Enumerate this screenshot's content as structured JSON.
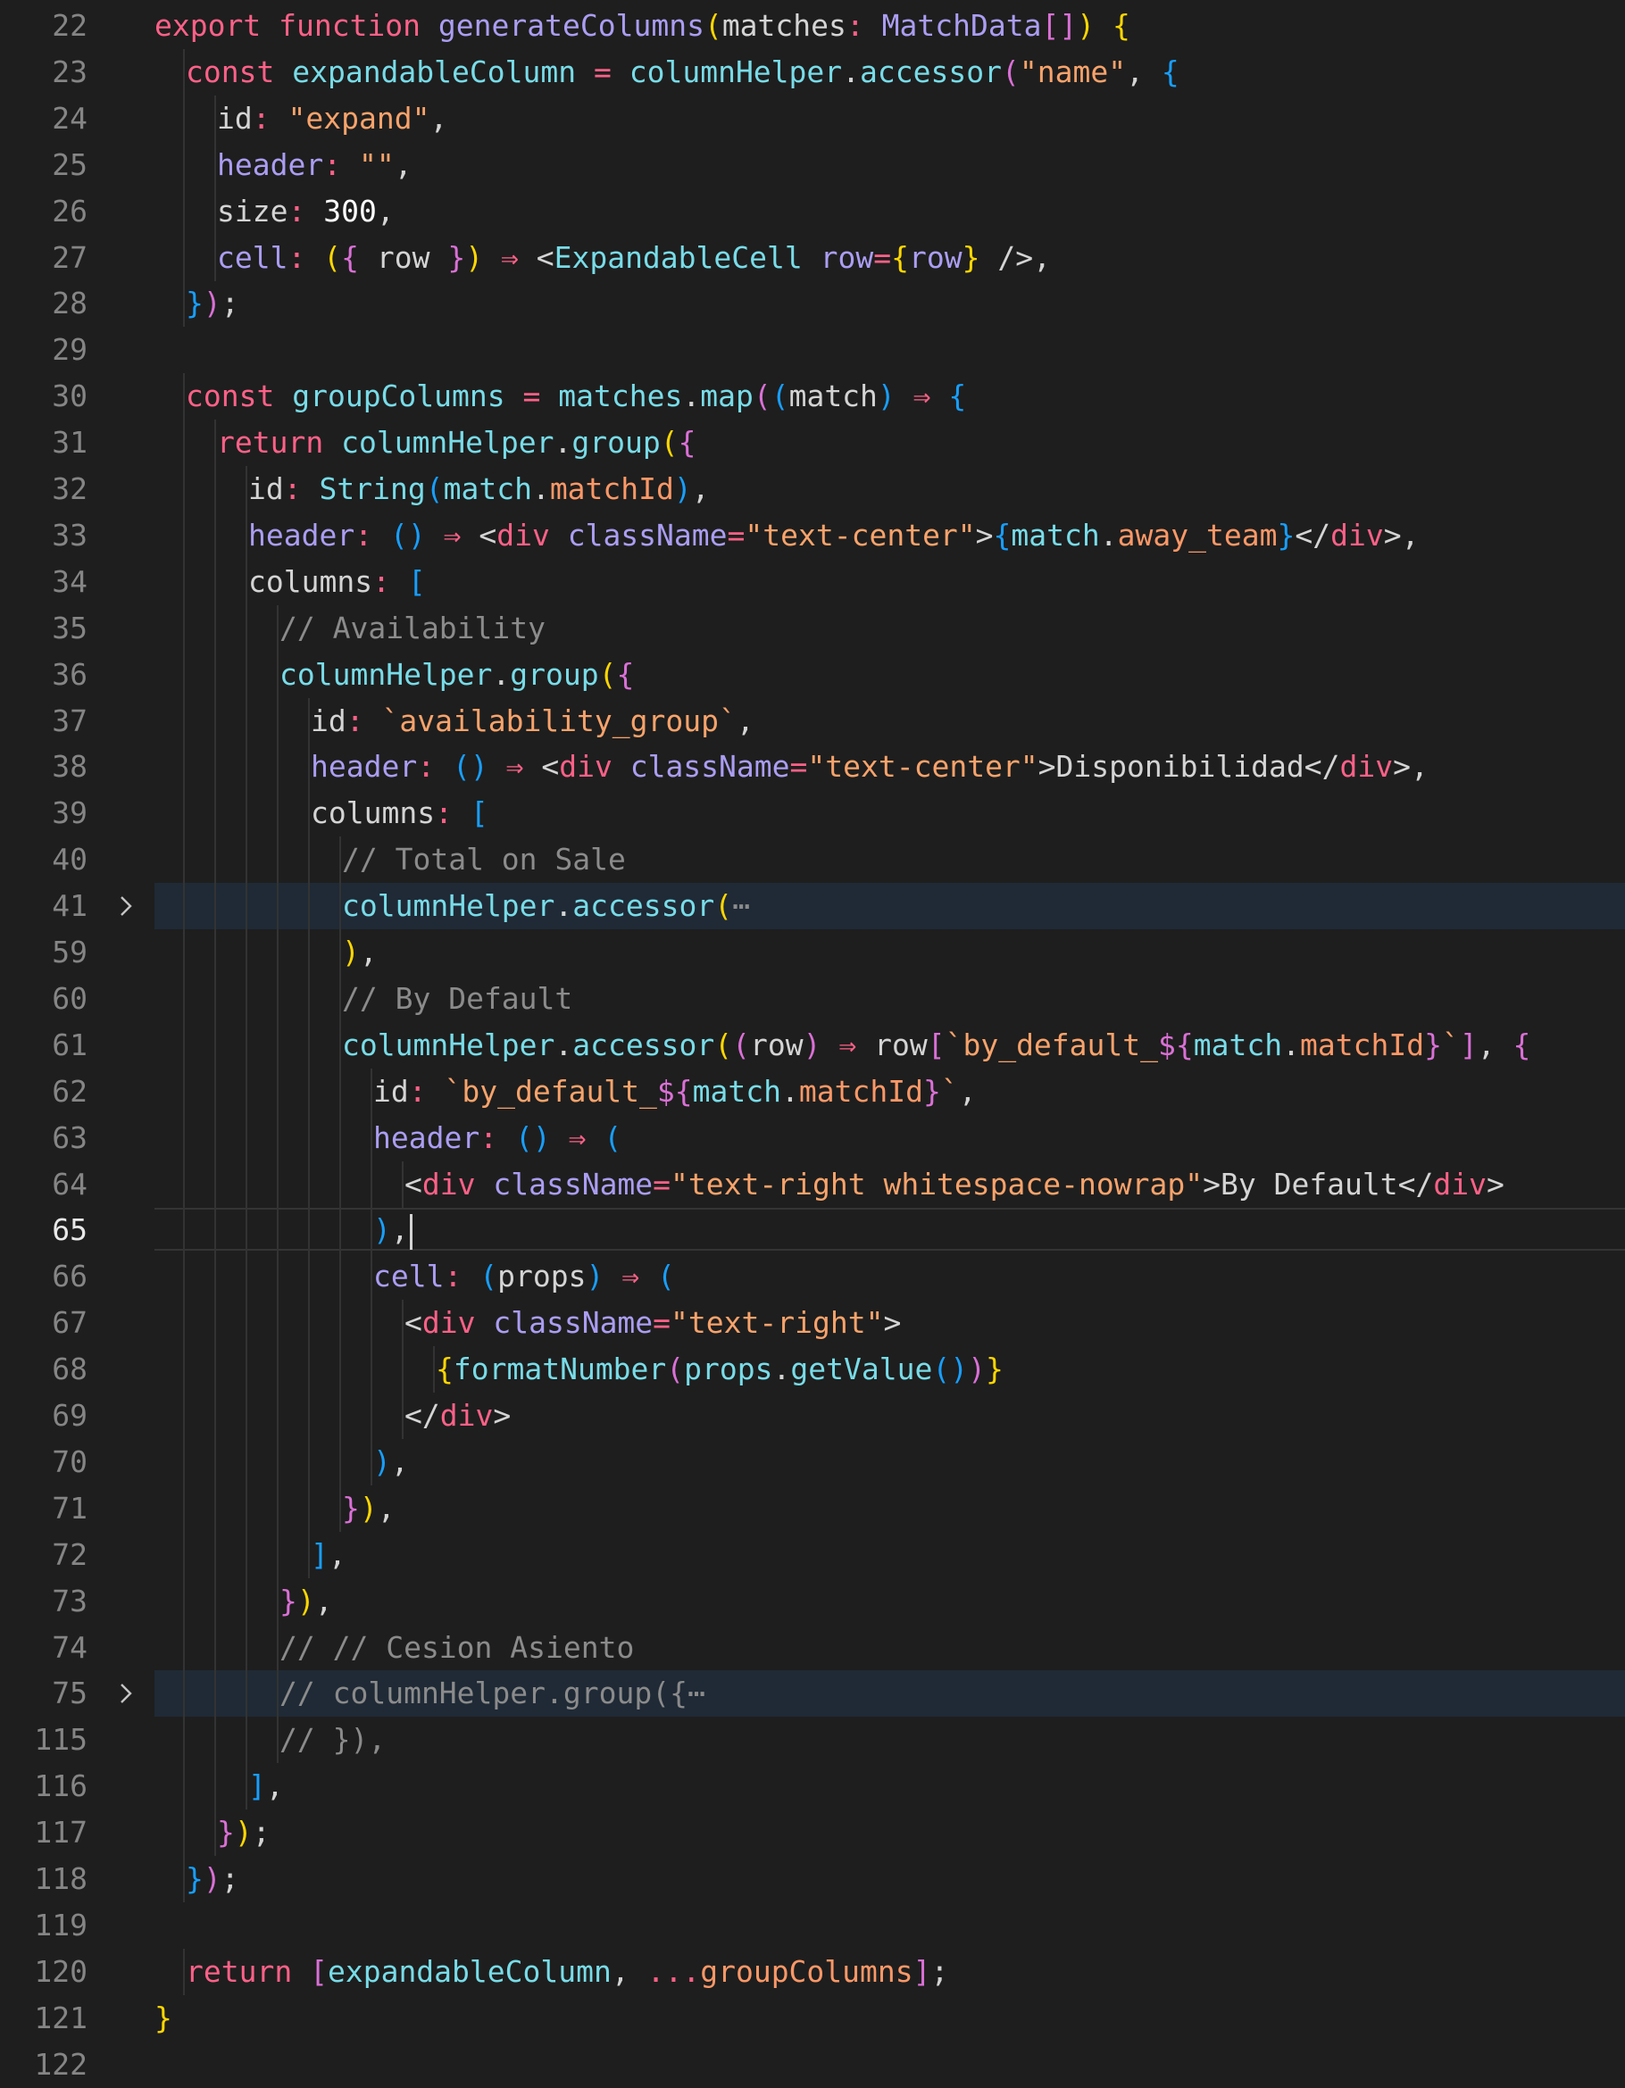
{
  "editor": {
    "language": "typescriptreact",
    "current_line": "65",
    "colors": {
      "background": "#1e1e1e",
      "line_number": "#858585",
      "folded_highlight": "#1f2a36"
    },
    "lines": [
      {
        "n": "22",
        "indent": 0,
        "text": "export function generateColumns(matches: MatchData[]) {"
      },
      {
        "n": "23",
        "indent": 1,
        "text": "const expandableColumn = columnHelper.accessor(\"name\", {"
      },
      {
        "n": "24",
        "indent": 2,
        "text": "id: \"expand\","
      },
      {
        "n": "25",
        "indent": 2,
        "text": "header: \"\","
      },
      {
        "n": "26",
        "indent": 2,
        "text": "size: 300,"
      },
      {
        "n": "27",
        "indent": 2,
        "text": "cell: ({ row }) ⇒ <ExpandableCell row={row} />,"
      },
      {
        "n": "28",
        "indent": 1,
        "text": "});"
      },
      {
        "n": "29",
        "indent": 0,
        "text": ""
      },
      {
        "n": "30",
        "indent": 1,
        "text": "const groupColumns = matches.map((match) ⇒ {"
      },
      {
        "n": "31",
        "indent": 2,
        "text": "return columnHelper.group({"
      },
      {
        "n": "32",
        "indent": 3,
        "text": "id: String(match.matchId),"
      },
      {
        "n": "33",
        "indent": 3,
        "text": "header: () ⇒ <div className=\"text-center\">{match.away_team}</div>,"
      },
      {
        "n": "34",
        "indent": 3,
        "text": "columns: ["
      },
      {
        "n": "35",
        "indent": 4,
        "text": "// Availability"
      },
      {
        "n": "36",
        "indent": 4,
        "text": "columnHelper.group({"
      },
      {
        "n": "37",
        "indent": 5,
        "text": "id: `availability_group`,"
      },
      {
        "n": "38",
        "indent": 5,
        "text": "header: () ⇒ <div className=\"text-center\">Disponibilidad</div>,"
      },
      {
        "n": "39",
        "indent": 5,
        "text": "columns: ["
      },
      {
        "n": "40",
        "indent": 6,
        "text": "// Total on Sale"
      },
      {
        "n": "41",
        "indent": 6,
        "text": "columnHelper.accessor(",
        "folded": true
      },
      {
        "n": "59",
        "indent": 6,
        "text": "),"
      },
      {
        "n": "60",
        "indent": 6,
        "text": "// By Default"
      },
      {
        "n": "61",
        "indent": 6,
        "text": "columnHelper.accessor((row) ⇒ row[`by_default_${match.matchId}`], {"
      },
      {
        "n": "62",
        "indent": 7,
        "text": "id: `by_default_${match.matchId}`,"
      },
      {
        "n": "63",
        "indent": 7,
        "text": "header: () ⇒ ("
      },
      {
        "n": "64",
        "indent": 8,
        "text": "<div className=\"text-right whitespace-nowrap\">By Default</div>"
      },
      {
        "n": "65",
        "indent": 7,
        "text": "),"
      },
      {
        "n": "66",
        "indent": 7,
        "text": "cell: (props) ⇒ ("
      },
      {
        "n": "67",
        "indent": 8,
        "text": "<div className=\"text-right\">"
      },
      {
        "n": "68",
        "indent": 9,
        "text": "{formatNumber(props.getValue())}"
      },
      {
        "n": "69",
        "indent": 8,
        "text": "</div>"
      },
      {
        "n": "70",
        "indent": 7,
        "text": "),"
      },
      {
        "n": "71",
        "indent": 6,
        "text": "}),"
      },
      {
        "n": "72",
        "indent": 5,
        "text": "],"
      },
      {
        "n": "73",
        "indent": 4,
        "text": "}),"
      },
      {
        "n": "74",
        "indent": 4,
        "text": "// // Cesion Asiento"
      },
      {
        "n": "75",
        "indent": 4,
        "text": "// columnHelper.group({",
        "folded": true
      },
      {
        "n": "115",
        "indent": 4,
        "text": "// }),"
      },
      {
        "n": "116",
        "indent": 3,
        "text": "],"
      },
      {
        "n": "117",
        "indent": 2,
        "text": "});"
      },
      {
        "n": "118",
        "indent": 1,
        "text": "});"
      },
      {
        "n": "119",
        "indent": 0,
        "text": ""
      },
      {
        "n": "120",
        "indent": 1,
        "text": "return [expandableColumn, ...groupColumns];"
      },
      {
        "n": "121",
        "indent": 0,
        "text": "}"
      },
      {
        "n": "122",
        "indent": 0,
        "text": ""
      }
    ],
    "fold_ellipsis": "⋯"
  }
}
